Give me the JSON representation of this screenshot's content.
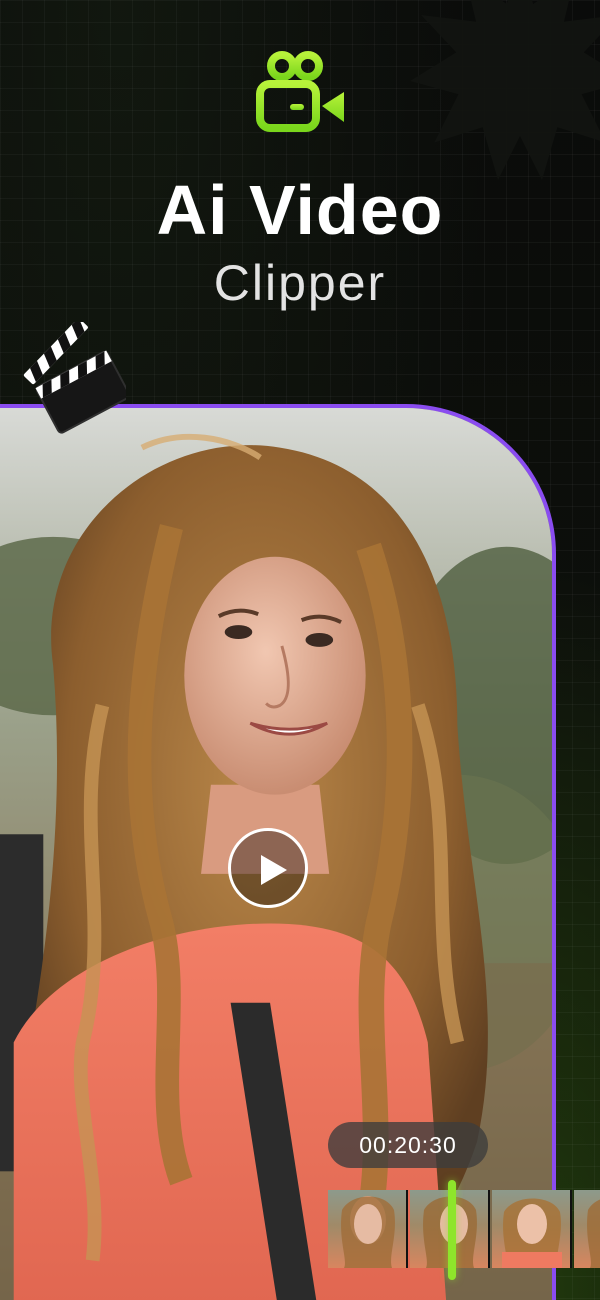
{
  "app": {
    "title": "Ai Video",
    "subtitle": "Clipper",
    "icon": "video-camera-icon",
    "accent_color": "#94e82b",
    "frame_color": "#8a4cf0"
  },
  "player": {
    "play_icon": "play-icon",
    "timestamp": "00:20:30"
  },
  "decor": {
    "clapperboard_icon": "clapperboard-icon"
  },
  "timeline": {
    "thumbnail_count": 4
  }
}
